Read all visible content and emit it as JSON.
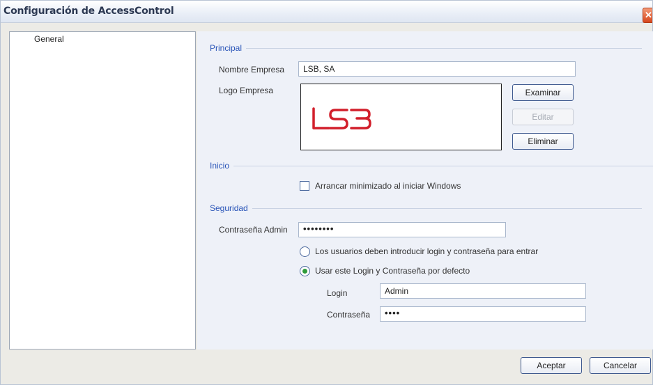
{
  "window": {
    "title": "Configuración de AccessControl",
    "close_symbol": "✕"
  },
  "sidebar": {
    "items": [
      {
        "label": "General"
      }
    ]
  },
  "principal": {
    "title": "Principal",
    "company_name_label": "Nombre Empresa",
    "company_name_value": "LSB, SA",
    "logo_label": "Logo Empresa",
    "logo_text": "LSB",
    "logo_color": "#d21f2b",
    "browse_label": "Examinar",
    "edit_label": "Editar",
    "delete_label": "Eliminar"
  },
  "inicio": {
    "title": "Inicio",
    "start_minimized_label": "Arrancar minimizado al iniciar Windows",
    "start_minimized_checked": false
  },
  "seguridad": {
    "title": "Seguridad",
    "admin_password_label": "Contraseña Admin",
    "admin_password_value": "••••••••",
    "option_require_login_label": "Los usuarios deben introducir login y contraseña para entrar",
    "option_default_login_label": "Usar este Login y Contraseña por defecto",
    "selected_option": "default_login",
    "login_label": "Login",
    "login_value": "Admin",
    "password_label": "Contraseña",
    "password_value": "••••"
  },
  "footer": {
    "accept_label": "Aceptar",
    "cancel_label": "Cancelar"
  }
}
